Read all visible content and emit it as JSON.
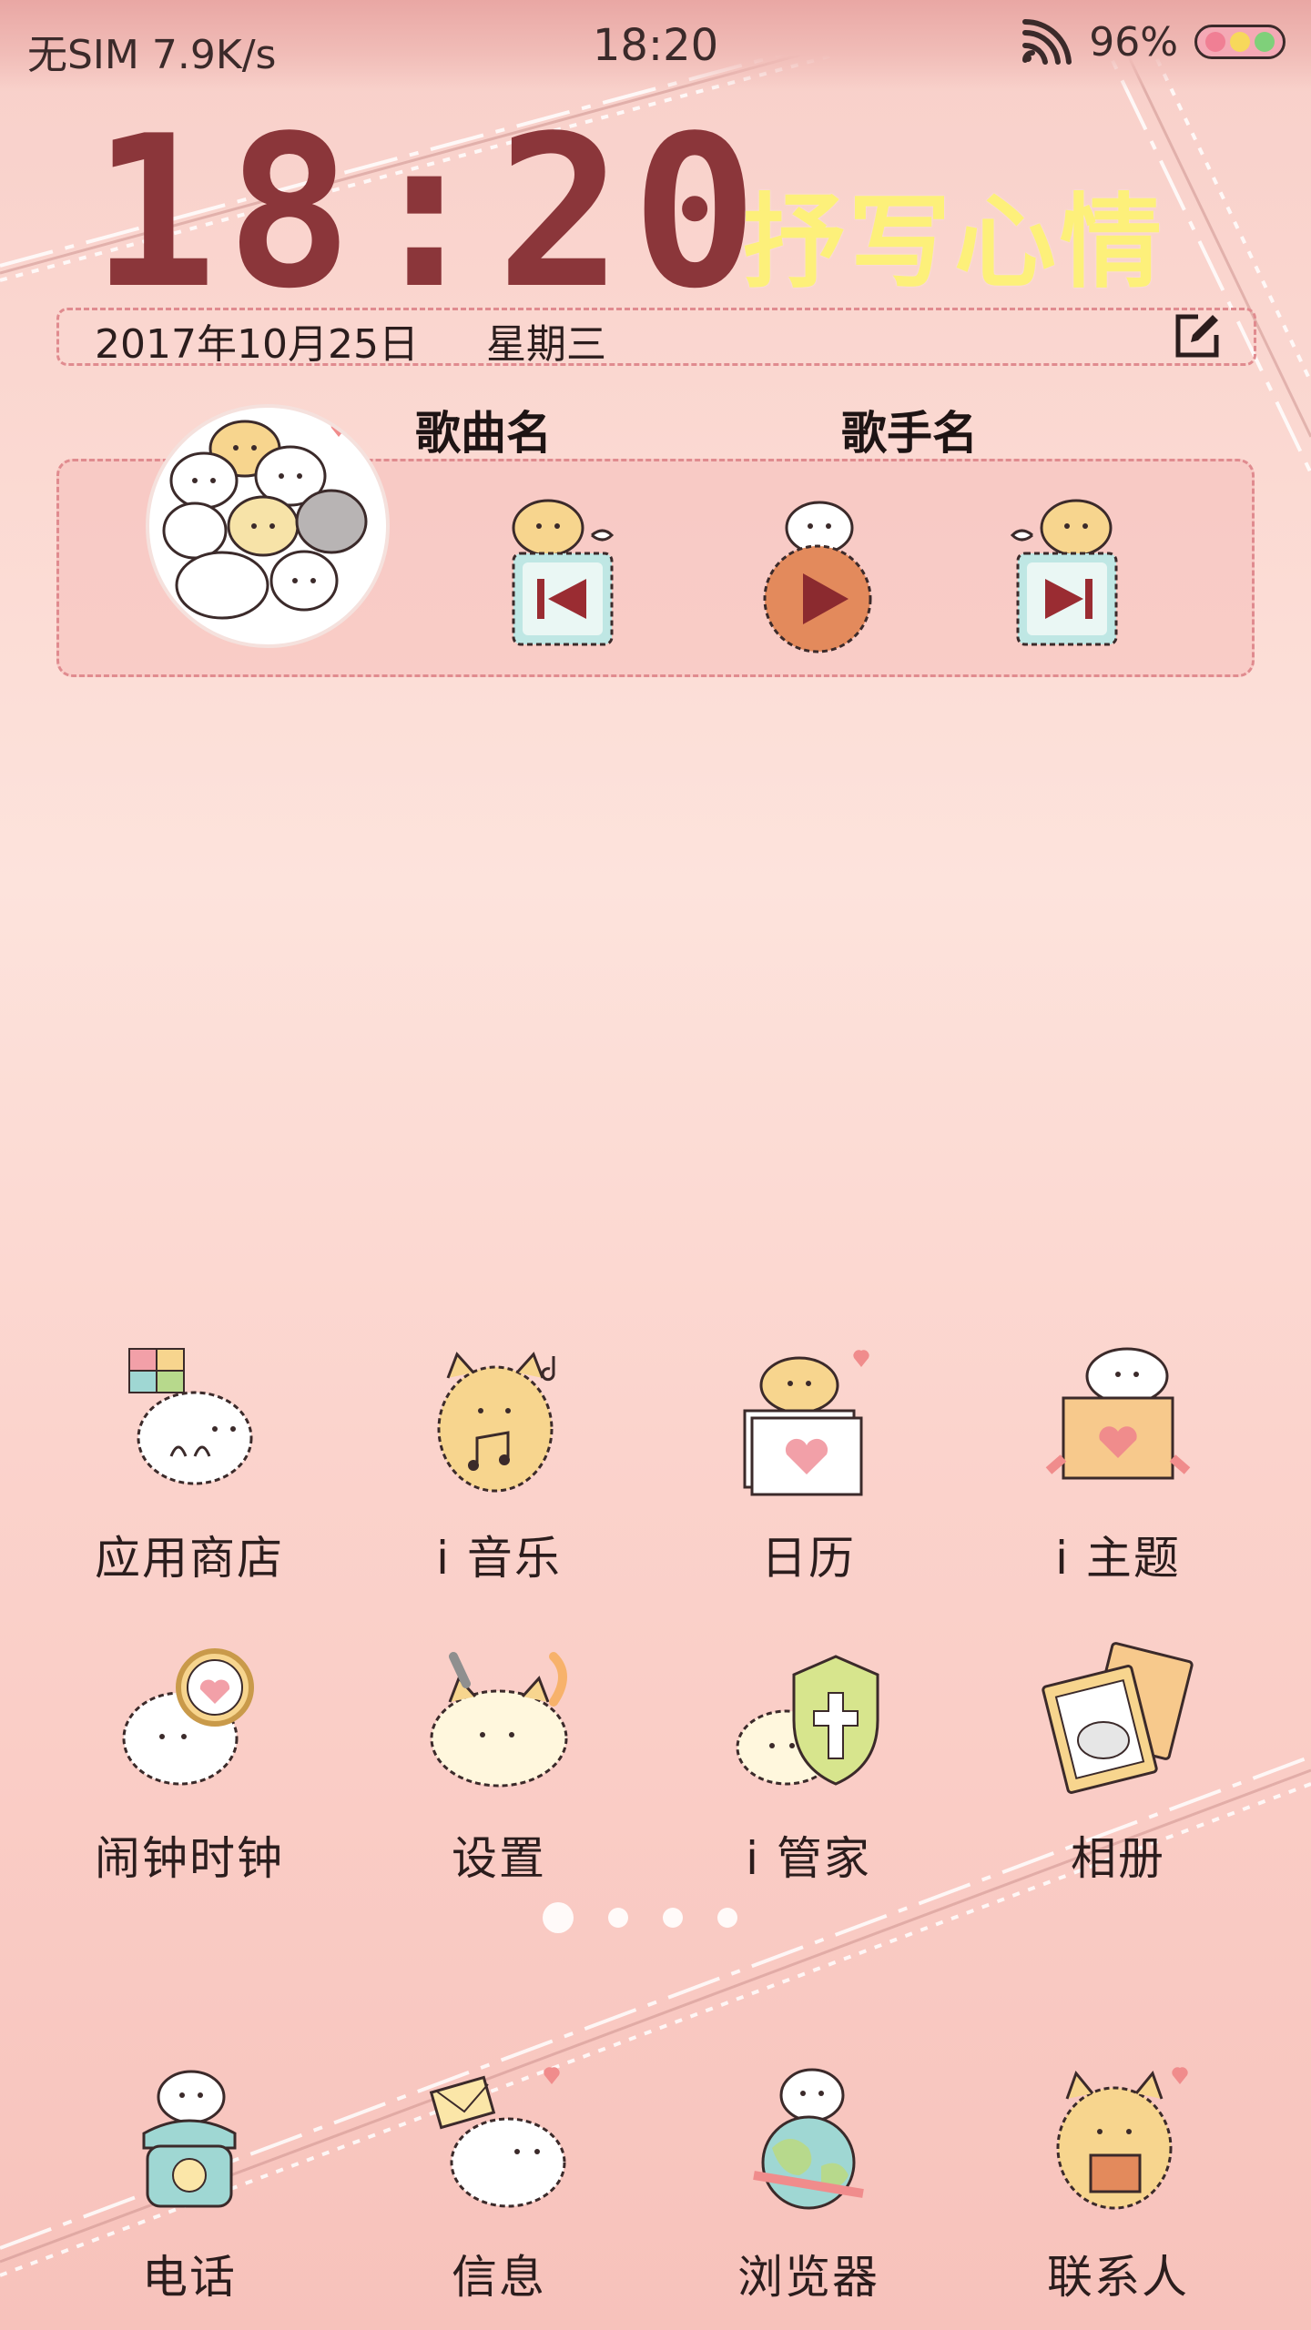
{
  "status_bar": {
    "carrier": "无SIM",
    "net_speed": "7.9K/s",
    "time": "18:20",
    "battery": "96%",
    "icons": [
      "wifi-icon",
      "battery-icon"
    ]
  },
  "widget": {
    "clock": "18:20",
    "mood_text": "抒写心情",
    "date": "2017年10月25日",
    "weekday": "星期三",
    "edit_icon": "edit-icon"
  },
  "music": {
    "song": "歌曲名",
    "artist": "歌手名",
    "controls": [
      "previous-icon",
      "play-icon",
      "next-icon"
    ]
  },
  "apps": [
    {
      "label": "应用商店",
      "icon": "app-store-icon"
    },
    {
      "label": "i 音乐",
      "icon": "music-icon"
    },
    {
      "label": "日历",
      "icon": "calendar-icon"
    },
    {
      "label": "i 主题",
      "icon": "theme-icon"
    },
    {
      "label": "闹钟时钟",
      "icon": "alarm-clock-icon"
    },
    {
      "label": "设置",
      "icon": "settings-icon"
    },
    {
      "label": "i 管家",
      "icon": "manager-shield-icon"
    },
    {
      "label": "相册",
      "icon": "gallery-icon"
    }
  ],
  "pager": {
    "pages": 4,
    "active": 1
  },
  "dock": [
    {
      "label": "电话",
      "icon": "phone-icon"
    },
    {
      "label": "信息",
      "icon": "message-icon"
    },
    {
      "label": "浏览器",
      "icon": "browser-globe-icon"
    },
    {
      "label": "联系人",
      "icon": "contacts-icon"
    }
  ],
  "colors": {
    "clock": "#8b363a",
    "mood": "#fdf07a",
    "dashed_border": "#e08b8f",
    "background": "#fbd9d2"
  }
}
